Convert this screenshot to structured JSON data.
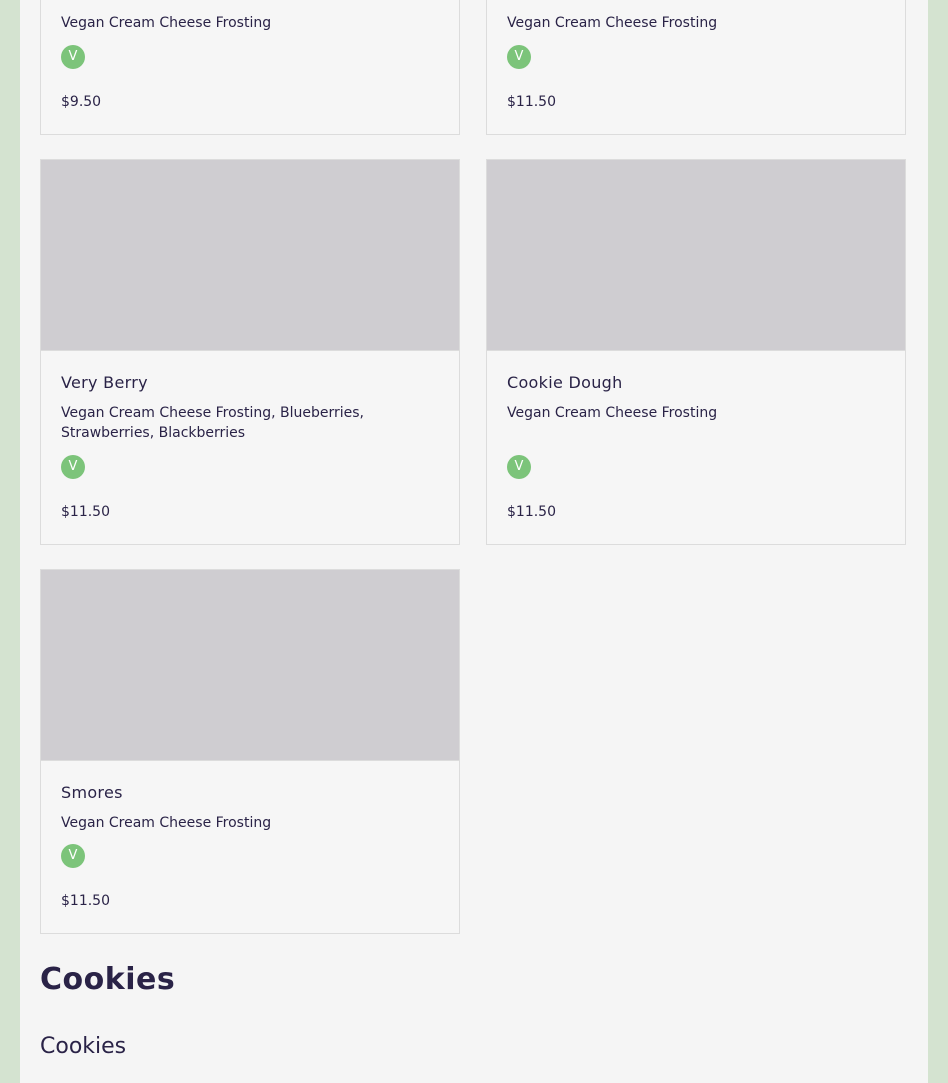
{
  "cards_top": [
    {
      "description": "Vegan Cream Cheese Frosting",
      "badge": "V",
      "price": "$9.50"
    },
    {
      "description": "Vegan Cream Cheese Frosting",
      "badge": "V",
      "price": "$11.50"
    }
  ],
  "cards": [
    {
      "name": "Very Berry",
      "description": "Vegan Cream Cheese Frosting, Blueberries, Strawberries, Blackberries",
      "badge": "V",
      "price": "$11.50"
    },
    {
      "name": "Cookie Dough",
      "description": "Vegan Cream Cheese Frosting",
      "badge": "V",
      "price": "$11.50"
    },
    {
      "name": "Smores",
      "description": "Vegan Cream Cheese Frosting",
      "badge": "V",
      "price": "$11.50"
    }
  ],
  "section": {
    "title": "Cookies",
    "subtitle": "Cookies"
  },
  "colors": {
    "vegan_badge": "#7cc47a",
    "page_bg": "#d4e3d0",
    "text": "#2a2347"
  }
}
